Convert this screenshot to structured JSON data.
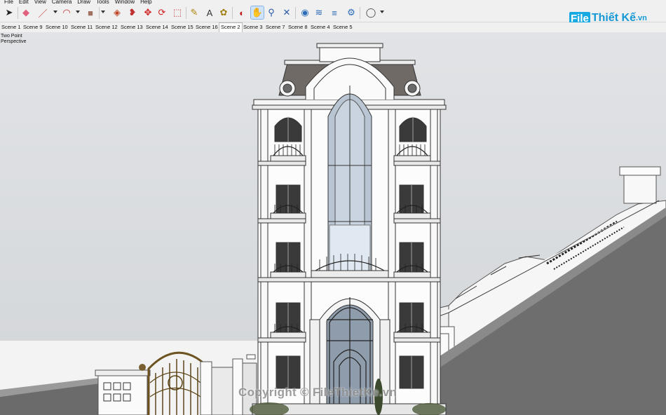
{
  "menu": [
    "File",
    "Edit",
    "View",
    "Camera",
    "Draw",
    "Tools",
    "Window",
    "Help"
  ],
  "toolbar": {
    "tools": [
      {
        "icon": "select-arrow-icon",
        "glyph": "➤",
        "color": "#222"
      },
      {
        "icon": "eraser-icon",
        "glyph": "◆",
        "color": "#e0607e"
      },
      {
        "icon": "pencil-line-icon",
        "glyph": "／",
        "color": "#c23030"
      },
      {
        "icon": "arc-icon",
        "glyph": "◠",
        "color": "#c23030"
      },
      {
        "icon": "rectangle-shape-icon",
        "glyph": "■",
        "color": "#a07060"
      },
      {
        "icon": "push-pull-icon",
        "glyph": "◈",
        "color": "#c04020"
      },
      {
        "icon": "follow-me-icon",
        "glyph": "❥",
        "color": "#c03030"
      },
      {
        "icon": "move-icon",
        "glyph": "✥",
        "color": "#d02020"
      },
      {
        "icon": "rotate-icon",
        "glyph": "⟳",
        "color": "#d02020"
      },
      {
        "icon": "scale-icon",
        "glyph": "⬚",
        "color": "#c03030"
      },
      {
        "icon": "tape-measure-icon",
        "glyph": "✎",
        "color": "#b08a10"
      },
      {
        "icon": "text-icon",
        "glyph": "A",
        "color": "#333"
      },
      {
        "icon": "paint-bucket-icon",
        "glyph": "✿",
        "color": "#a08010"
      },
      {
        "icon": "orbit-icon",
        "glyph": "◐",
        "color": "#c02020"
      },
      {
        "icon": "pan-hand-icon",
        "glyph": "✋",
        "color": "#b07030"
      },
      {
        "icon": "zoom-icon",
        "glyph": "⚲",
        "color": "#2a5aa8"
      },
      {
        "icon": "zoom-extents-icon",
        "glyph": "✕",
        "color": "#2a5aa8"
      },
      {
        "icon": "warehouse-icon",
        "glyph": "◉",
        "color": "#2a6ab8"
      },
      {
        "icon": "extension-warehouse-icon",
        "glyph": "≋",
        "color": "#2a6ab8"
      },
      {
        "icon": "layout-icon",
        "glyph": "≡",
        "color": "#2a6ab8"
      },
      {
        "icon": "extension-manager-icon",
        "glyph": "⚙",
        "color": "#2a6ab8"
      },
      {
        "icon": "account-icon",
        "glyph": "◯",
        "color": "#444"
      }
    ]
  },
  "logo": {
    "part1": "File",
    "part2": "Thiết Kế",
    "part3": ".vn"
  },
  "tabs": [
    "Scene 1",
    "Scene 9",
    "Scene 10",
    "Scene 11",
    "Scene 12",
    "Scene 13",
    "Scene 14",
    "Scene 15",
    "Scene 16",
    "Scene 2",
    "Scene 3",
    "Scene 7",
    "Scene 8",
    "Scene 4",
    "Scene 5"
  ],
  "active_tab": "Scene 2",
  "camera": {
    "line1": "Two Point",
    "line2": "Perspective"
  },
  "watermark": "Copyright © FileThietKe.vn",
  "colors": {
    "sky": "#dadde0",
    "ground": "#f2f2f2",
    "roof": "#6f6f6f",
    "glass": "#b7c4d2",
    "accent": "#cfe4fb"
  }
}
